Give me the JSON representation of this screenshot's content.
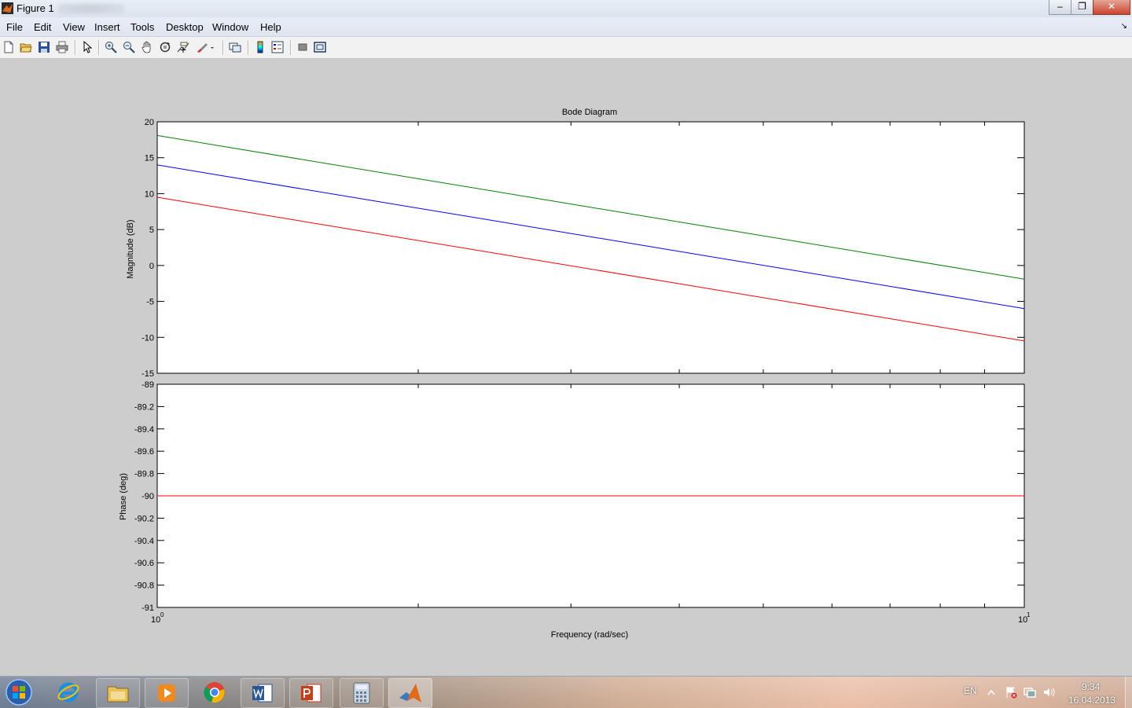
{
  "window": {
    "title": "Figure 1",
    "buttons": [
      "‒",
      "❐",
      "✕"
    ]
  },
  "menu": [
    "File",
    "Edit",
    "View",
    "Insert",
    "Tools",
    "Desktop",
    "Window",
    "Help"
  ],
  "menu_dock_glyph": "↘",
  "toolbar": {
    "icons": [
      "new-figure-icon",
      "open-file-icon",
      "save-icon",
      "print-icon",
      "edit-plot-arrow-icon",
      "zoom-in-icon",
      "zoom-out-icon",
      "pan-hand-icon",
      "rotate-3d-icon",
      "data-cursor-icon",
      "brush-icon",
      "link-plot-icon",
      "colorbar-icon",
      "legend-icon",
      "hide-plot-tools-icon",
      "show-plot-tools-icon"
    ]
  },
  "chart_data": {
    "type": "line",
    "title": "Bode Diagram",
    "xlabel": "Frequency  (rad/sec)",
    "xscale": "log",
    "xlim": [
      1,
      10
    ],
    "x_tick_labels": [
      {
        "base": "10",
        "exp": "0"
      },
      {
        "base": "10",
        "exp": "1"
      }
    ],
    "grid": false,
    "subplots": [
      {
        "name": "magnitude",
        "ylabel": "Magnitude (dB)",
        "ylim": [
          -15,
          20
        ],
        "yticks": [
          20,
          15,
          10,
          5,
          0,
          -5,
          -10,
          -15
        ],
        "series": [
          {
            "color": "#008000",
            "x": [
              1,
              10
            ],
            "y": [
              18.1,
              -1.9
            ]
          },
          {
            "color": "#0000ff",
            "x": [
              1,
              10
            ],
            "y": [
              14.0,
              -6.0
            ]
          },
          {
            "color": "#ff0000",
            "x": [
              1,
              10
            ],
            "y": [
              9.5,
              -10.5
            ]
          }
        ]
      },
      {
        "name": "phase",
        "ylabel": "Phase (deg)",
        "ylim": [
          -91,
          -89
        ],
        "yticks": [
          -89,
          -89.2,
          -89.4,
          -89.6,
          -89.8,
          -90,
          -90.2,
          -90.4,
          -90.6,
          -90.8,
          -91
        ],
        "series": [
          {
            "color": "#ff0000",
            "x": [
              1,
              10
            ],
            "y": [
              -90,
              -90
            ]
          }
        ]
      }
    ]
  },
  "taskbar": {
    "apps": [
      "internet-explorer-icon",
      "file-explorer-icon",
      "media-player-icon",
      "chrome-icon",
      "word-icon",
      "powerpoint-icon",
      "calculator-icon",
      "matlab-icon"
    ],
    "language": "EN",
    "time": "9:34",
    "date": "16.04.2013"
  },
  "colors": {
    "figure_bg": "#cdcdcd",
    "axes_bg": "#ffffff"
  }
}
